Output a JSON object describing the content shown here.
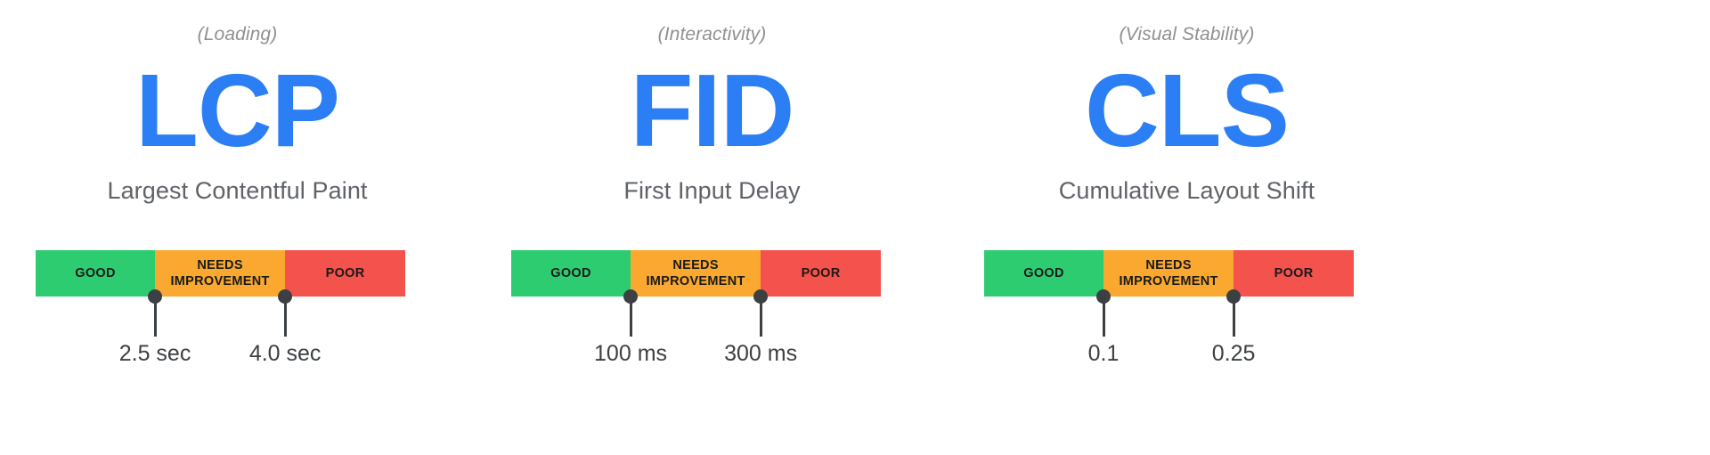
{
  "page": {
    "background": "#ffffff",
    "accent_blue": "#2b7ef4",
    "muted_gray": "#5f6368",
    "label_gray": "#8e9093",
    "marker_color": "#3c4043"
  },
  "colors": {
    "good": "#2ecc71",
    "needs_improvement": "#faa82f",
    "poor": "#f4524c"
  },
  "segments": {
    "good_label": "GOOD",
    "needs_improvement_label_line1": "NEEDS",
    "needs_improvement_label_line2": "IMPROVEMENT",
    "poor_label": "POOR"
  },
  "metrics": [
    {
      "category": "(Loading)",
      "acronym": "LCP",
      "fullname": "Largest Contentful Paint",
      "thresholds": [
        {
          "label": "2.5 sec",
          "position_pct": 32.3
        },
        {
          "label": "4.0 sec",
          "position_pct": 67.5
        }
      ],
      "bands": [
        {
          "name": "GOOD",
          "color": "#2ecc71",
          "range": "0 – 2.5 sec"
        },
        {
          "name": "NEEDS IMPROVEMENT",
          "color": "#faa82f",
          "range": "2.5 – 4.0 sec"
        },
        {
          "name": "POOR",
          "color": "#f4524c",
          "range": "> 4.0 sec"
        }
      ]
    },
    {
      "category": "(Interactivity)",
      "acronym": "FID",
      "fullname": "First Input Delay",
      "thresholds": [
        {
          "label": "100 ms",
          "position_pct": 32.3
        },
        {
          "label": "300 ms",
          "position_pct": 67.5
        }
      ],
      "bands": [
        {
          "name": "GOOD",
          "color": "#2ecc71",
          "range": "0 – 100 ms"
        },
        {
          "name": "NEEDS IMPROVEMENT",
          "color": "#faa82f",
          "range": "100 – 300 ms"
        },
        {
          "name": "POOR",
          "color": "#f4524c",
          "range": "> 300 ms"
        }
      ]
    },
    {
      "category": "(Visual Stability)",
      "acronym": "CLS",
      "fullname": "Cumulative Layout Shift",
      "thresholds": [
        {
          "label": "0.1",
          "position_pct": 32.3
        },
        {
          "label": "0.25",
          "position_pct": 67.5
        }
      ],
      "bands": [
        {
          "name": "GOOD",
          "color": "#2ecc71",
          "range": "0 – 0.1"
        },
        {
          "name": "NEEDS IMPROVEMENT",
          "color": "#faa82f",
          "range": "0.1 – 0.25"
        },
        {
          "name": "POOR",
          "color": "#f4524c",
          "range": "> 0.25"
        }
      ]
    }
  ],
  "chart_data": {
    "type": "bar",
    "title": "Core Web Vitals thresholds",
    "orientation": "horizontal",
    "grid": false,
    "legend": "none",
    "categories": [
      "GOOD",
      "NEEDS IMPROVEMENT",
      "POOR"
    ],
    "series": [
      {
        "name": "LCP",
        "unit": "sec",
        "thresholds": [
          2.5,
          4.0
        ],
        "band_widths_pct": [
          32.3,
          35.2,
          32.5
        ]
      },
      {
        "name": "FID",
        "unit": "ms",
        "thresholds": [
          100,
          300
        ],
        "band_widths_pct": [
          32.3,
          35.2,
          32.5
        ]
      },
      {
        "name": "CLS",
        "unit": "",
        "thresholds": [
          0.1,
          0.25
        ],
        "band_widths_pct": [
          32.3,
          35.2,
          32.5
        ]
      }
    ]
  }
}
